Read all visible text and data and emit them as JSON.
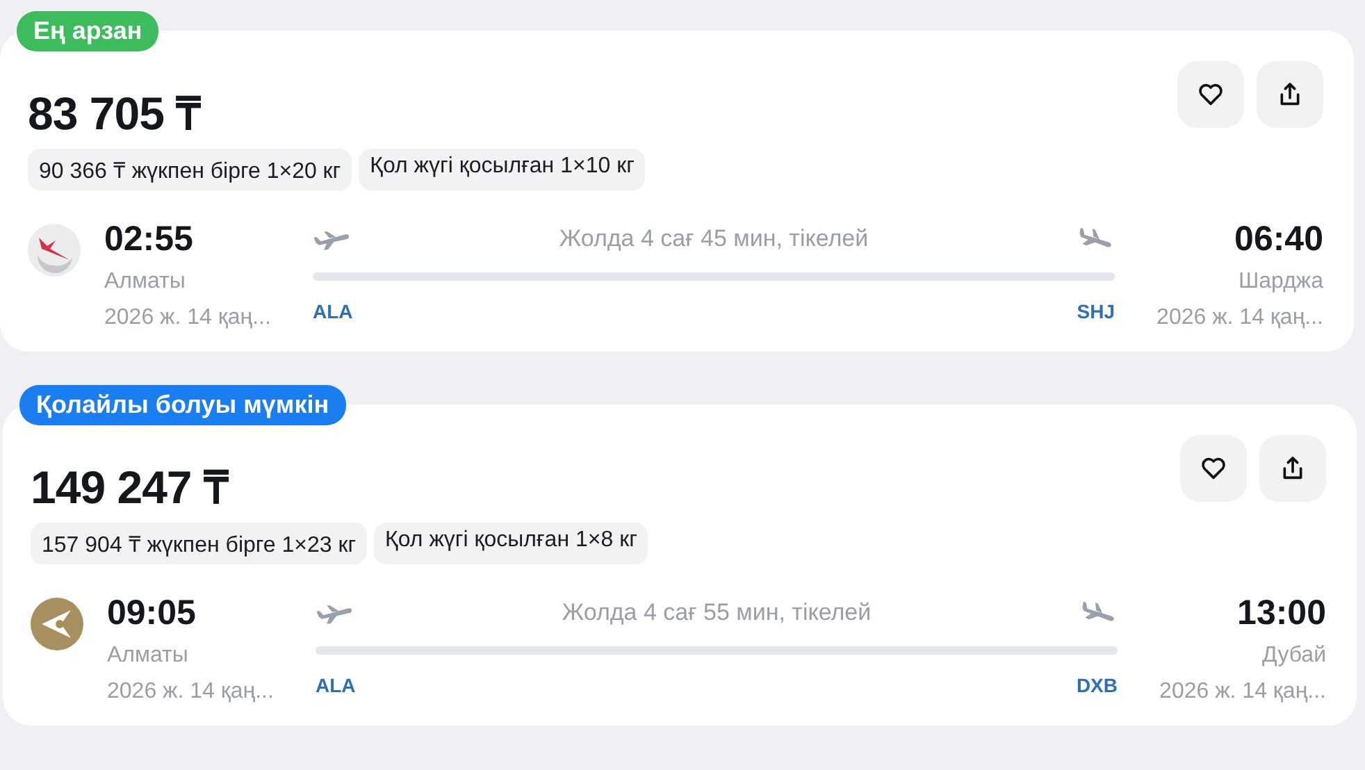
{
  "offers": [
    {
      "badge": {
        "label": "Ең арзан",
        "color": "#3dbb5d"
      },
      "price": "83 705 ₸",
      "options": [
        "90 366 ₸ жүкпен бірге 1×20 кг",
        "Қол жүгі қосылған 1×10 кг"
      ],
      "airline": {
        "kind": "bird"
      },
      "depart": {
        "time": "02:55",
        "city": "Алматы",
        "date": "2026 ж. 14 қаң...",
        "code": "ALA"
      },
      "duration": "Жолда 4 сағ 45 мин, тікелей",
      "arrive": {
        "time": "06:40",
        "city": "Шарджа",
        "date": "2026 ж. 14 қаң...",
        "code": "SHJ"
      }
    },
    {
      "badge": {
        "label": "Қолайлы болуы мүмкін",
        "color": "#1a7ef0"
      },
      "price": "149 247 ₸",
      "options": [
        "157 904 ₸ жүкпен бірге 1×23 кг",
        "Қол жүгі қосылған 1×8 кг"
      ],
      "airline": {
        "kind": "emblem"
      },
      "depart": {
        "time": "09:05",
        "city": "Алматы",
        "date": "2026 ж. 14 қаң...",
        "code": "ALA"
      },
      "duration": "Жолда 4 сағ 55 мин, тікелей",
      "arrive": {
        "time": "13:00",
        "city": "Дубай",
        "date": "2026 ж. 14 қаң...",
        "code": "DXB"
      }
    }
  ]
}
